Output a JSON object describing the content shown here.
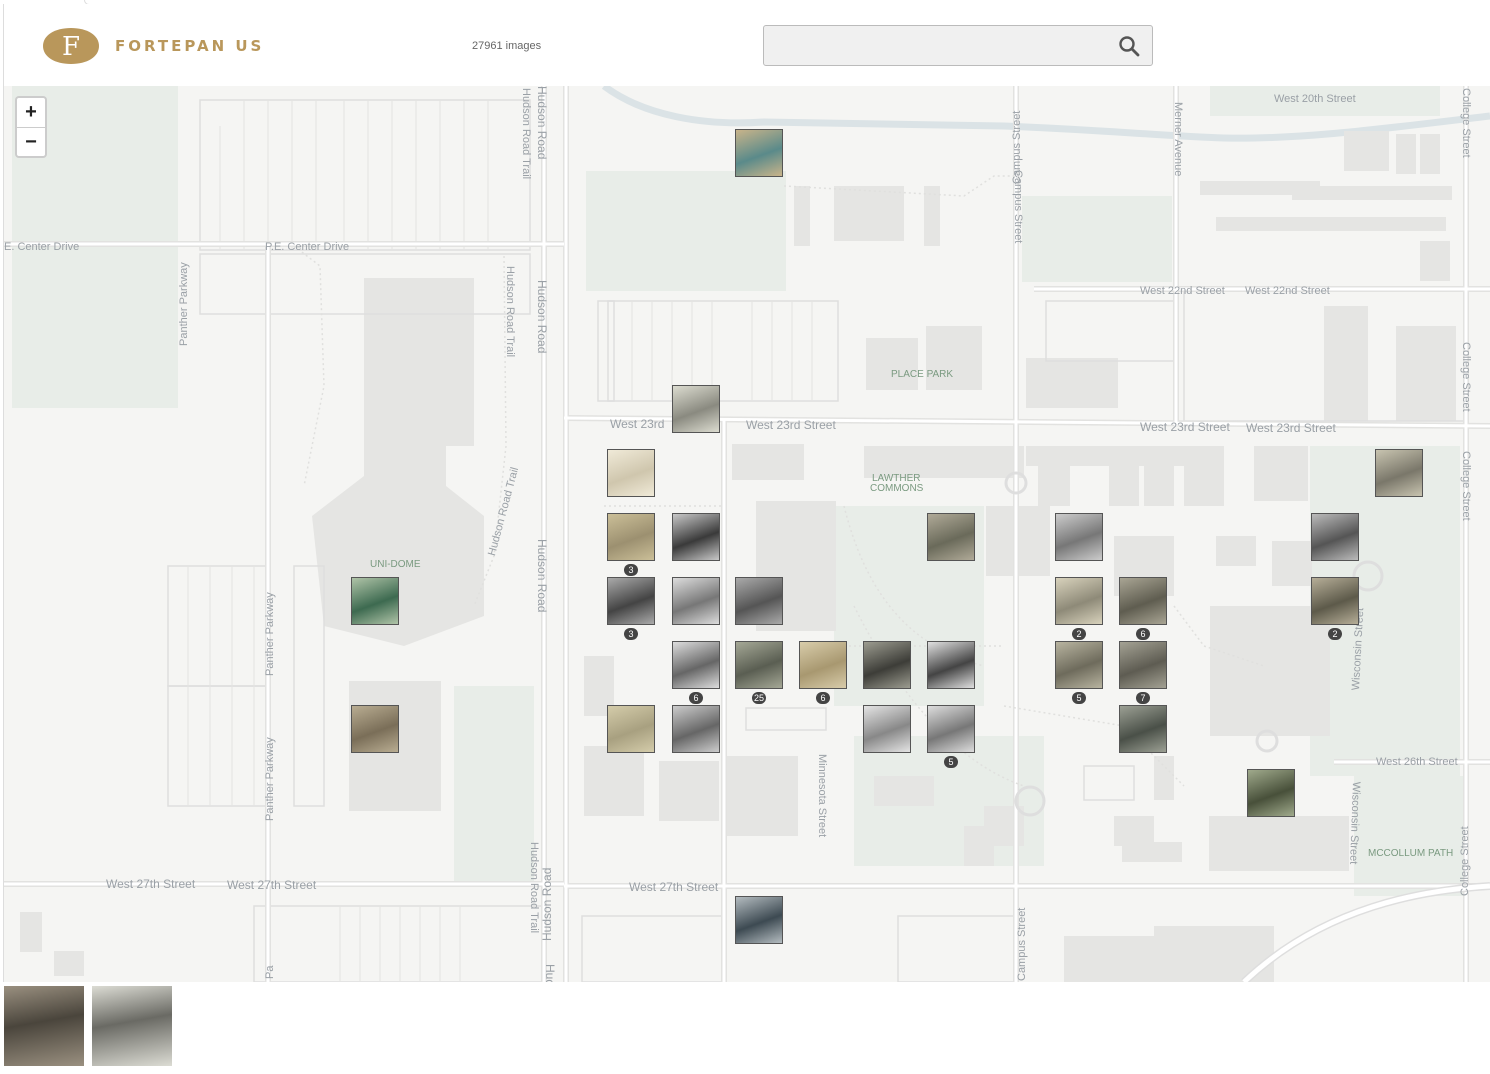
{
  "app": {
    "name": "FORTEPAN US",
    "logo_letter": "F",
    "brand_color": "#b9975b"
  },
  "header": {
    "image_count": "27961 images"
  },
  "search": {
    "placeholder": "",
    "value": ""
  },
  "zoom": {
    "in_label": "+",
    "out_label": "−"
  },
  "map": {
    "streets": {
      "west_20th": "West 20th Street",
      "pe_center_left": "E. Center Drive",
      "pe_center": "P.E. Center Drive",
      "panther_1": "Panther Parkway",
      "panther_2": "Panther Parkway",
      "panther_3": "Panther Parkway",
      "panther_4": "Pa",
      "hudson_trail_1": "Hudson Road Trail",
      "hudson_trail_2": "Hudson Road Trail",
      "hudson_trail_3": "Hudson Road Trail",
      "hudson_trail_4": "Hudson Road Trail",
      "hudson_1": "Hudson Road",
      "hudson_2": "Hudson Road",
      "hudson_3": "Hudson Road",
      "hudson_4": "Hudson Road",
      "hudson_5": "Hudson Road",
      "campus_1": "Campus Street",
      "campus_2": "Campus Street",
      "campus_3": "Campus Street",
      "merner": "Merner Avenue",
      "college_1": "College Street",
      "college_2": "College Street",
      "college_3": "College Street",
      "college_4": "College Street",
      "west_22nd_1": "West 22nd Street",
      "west_22nd_2": "West 22nd Street",
      "west_23rd_1": "West 23rd",
      "west_23rd_2": "West 23rd Street",
      "west_23rd_3": "West 23rd Street",
      "west_23rd_4": "West 23rd Street",
      "minnesota": "Minnesota Street",
      "wisconsin_1": "Wisconsin Street",
      "wisconsin_2": "Wisconsin Street",
      "west_26th": "West 26th Street",
      "west_27th_1": "West 27th Street",
      "west_27th_2": "West 27th Street",
      "west_27th_3": "West 27th Street"
    },
    "places": {
      "place_park": "PLACE PARK",
      "lawther_1": "LAWTHER",
      "lawther_2": "COMMONS",
      "uni_dome": "UNI-DOME",
      "mccollum": "MCCOLLUM PATH"
    },
    "markers": [
      {
        "badge": "",
        "c1": "#5a8a8a",
        "c2": "#c9b48a"
      },
      {
        "badge": "",
        "c1": "#8a8a80",
        "c2": "#dcdcd0"
      },
      {
        "badge": "",
        "c1": "#cfc6ad",
        "c2": "#f0ead8"
      },
      {
        "badge": "3",
        "c1": "#9c9070",
        "c2": "#cbbf98"
      },
      {
        "badge": "",
        "c1": "#3a3a3a",
        "c2": "#c8c8c8"
      },
      {
        "badge": "",
        "c1": "#6a6a5a",
        "c2": "#b0aa98"
      },
      {
        "badge": "",
        "c1": "#777",
        "c2": "#ccc"
      },
      {
        "badge": "",
        "c1": "#7a776a",
        "c2": "#c8c4b0"
      },
      {
        "badge": "",
        "c1": "#555",
        "c2": "#bbb"
      },
      {
        "badge": "3",
        "c1": "#444",
        "c2": "#aaa"
      },
      {
        "badge": "",
        "c1": "#777",
        "c2": "#ddd"
      },
      {
        "badge": "",
        "c1": "#555",
        "c2": "#aaa"
      },
      {
        "badge": "2",
        "c1": "#8e8a78",
        "c2": "#d8d2bc"
      },
      {
        "badge": "6",
        "c1": "#5f5d50",
        "c2": "#a9a594"
      },
      {
        "badge": "2",
        "c1": "#5d5a4a",
        "c2": "#b6ae98"
      },
      {
        "badge": "6",
        "c1": "#666",
        "c2": "#ddd"
      },
      {
        "badge": "25",
        "c1": "#5a5e52",
        "c2": "#a5a896"
      },
      {
        "badge": "6",
        "c1": "#a89870",
        "c2": "#d8ccaa"
      },
      {
        "badge": "",
        "c1": "#3d3d38",
        "c2": "#9c9c90"
      },
      {
        "badge": "",
        "c1": "#444",
        "c2": "#e0e0e0"
      },
      {
        "badge": "5",
        "c1": "#6e6b5c",
        "c2": "#b8b4a0"
      },
      {
        "badge": "7",
        "c1": "#5e5c52",
        "c2": "#a4a294"
      },
      {
        "badge": "",
        "c1": "#a8a080",
        "c2": "#d4ccaa"
      },
      {
        "badge": "",
        "c1": "#666",
        "c2": "#ccc"
      },
      {
        "badge": "",
        "c1": "#888",
        "c2": "#e4e4e4"
      },
      {
        "badge": "5",
        "c1": "#777",
        "c2": "#ddd"
      },
      {
        "badge": "",
        "c1": "#4a5048",
        "c2": "#9ca094"
      },
      {
        "badge": "",
        "c1": "#3d6a50",
        "c2": "#b0c4a8"
      },
      {
        "badge": "",
        "c1": "#7a6e58",
        "c2": "#b9ad92"
      },
      {
        "badge": "",
        "c1": "#48503a",
        "c2": "#a0aa8c"
      }
    ]
  },
  "thumbnails": [
    {
      "c1": "#4a453c",
      "c2": "#9a9080"
    },
    {
      "c1": "#6a6a64",
      "c2": "#dcdcd4"
    }
  ]
}
